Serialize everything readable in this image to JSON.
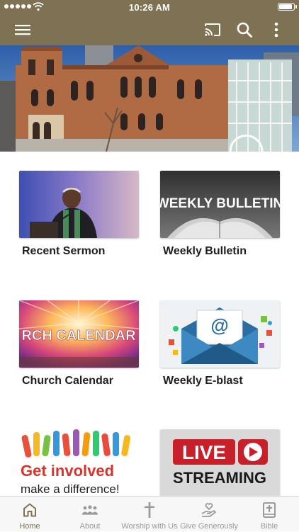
{
  "status": {
    "time": "10:26 AM",
    "battery_level": 0.95
  },
  "appbar": {
    "menu_icon": "hamburger-menu-icon",
    "cast_icon": "cast-icon",
    "search_icon": "search-icon",
    "more_icon": "more-vertical-icon"
  },
  "tiles": [
    {
      "label": "Recent Sermon",
      "image": "preacher-at-pulpit"
    },
    {
      "label": "Weekly Bulletin",
      "image": "open-book",
      "image_text": "WEEKLY BULLETIN"
    },
    {
      "label": "Church Calendar",
      "image": "sunburst-banner",
      "image_text": "RCH CALENDAR"
    },
    {
      "label": "Weekly E-blast",
      "image": "email-envelope"
    },
    {
      "label": "",
      "image": "raised-hands",
      "image_text_1": "Get involved",
      "image_text_2": "make a difference!"
    },
    {
      "label": "",
      "image": "live-streaming-logo",
      "image_text_1": "LIVE",
      "image_text_2": "STREAMING"
    }
  ],
  "tabs": [
    {
      "label": "Home",
      "icon": "home-icon",
      "active": true
    },
    {
      "label": "About",
      "icon": "people-icon",
      "active": false
    },
    {
      "label": "Worship with Us",
      "icon": "cross-icon",
      "active": false
    },
    {
      "label": "Give Generously",
      "icon": "giving-hand-icon",
      "active": false
    },
    {
      "label": "Bible",
      "icon": "bible-icon",
      "active": false
    }
  ],
  "colors": {
    "brand": "#7e7253",
    "tab_inactive": "#9a9a9a",
    "text": "#1e1e1e"
  }
}
